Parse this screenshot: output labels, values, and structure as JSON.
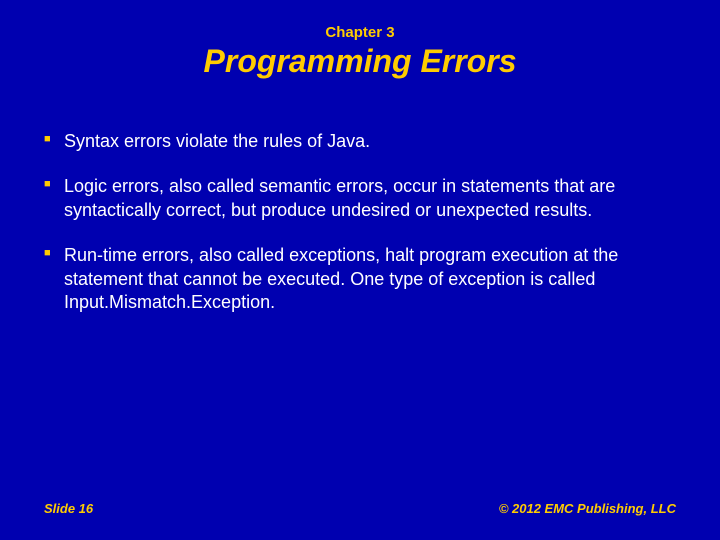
{
  "chapter": "Chapter 3",
  "title": "Programming Errors",
  "bullets": [
    "Syntax errors violate the rules of Java.",
    "Logic errors, also called semantic errors, occur in statements that are syntactically correct, but produce undesired or unexpected results.",
    "Run-time errors, also called exceptions, halt program execution at the statement that cannot be executed. One type of exception is called Input.Mismatch.Exception."
  ],
  "footer": {
    "left": "Slide 16",
    "right": "© 2012 EMC Publishing, LLC"
  }
}
